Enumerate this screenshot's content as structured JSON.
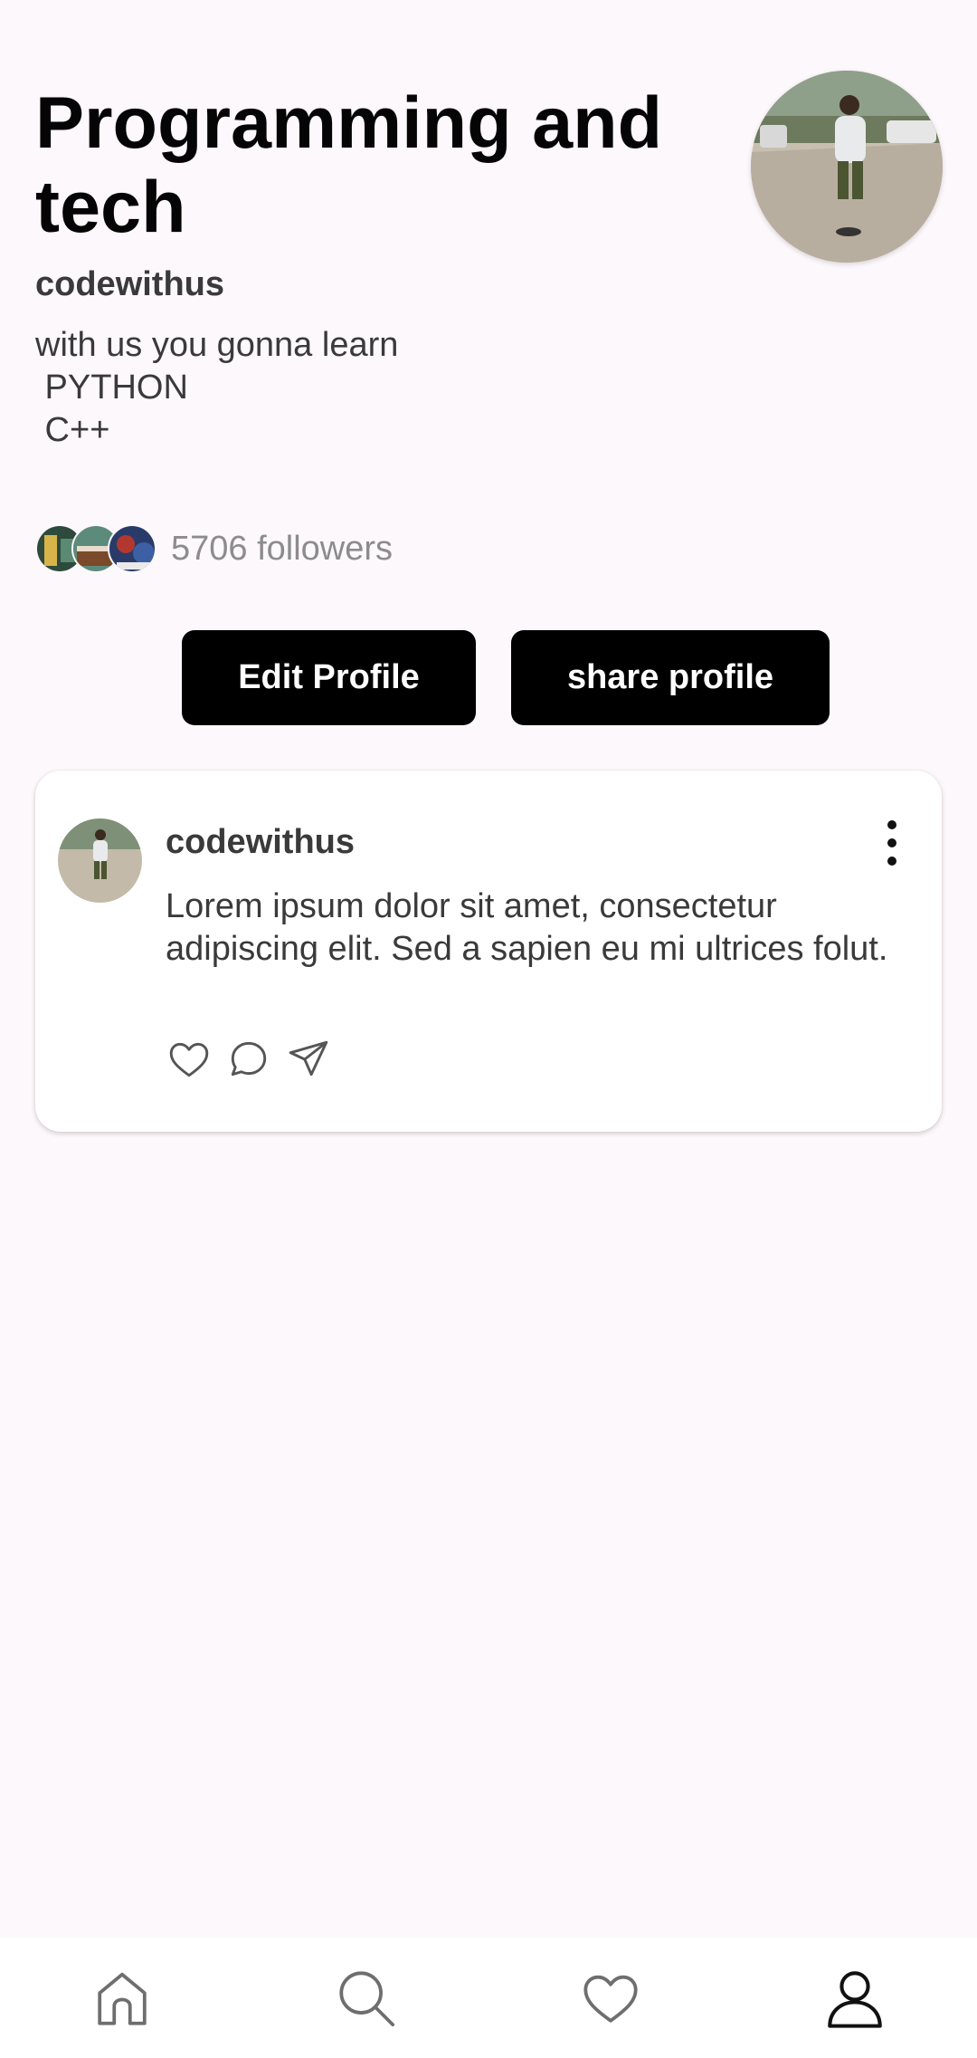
{
  "profile": {
    "title": "Programming and tech",
    "username": "codewithus",
    "bio": "with us you gonna learn\n PYTHON\n C++",
    "followers_text": "5706 followers"
  },
  "buttons": {
    "edit_label": "Edit Profile",
    "share_label": "share profile"
  },
  "post": {
    "username": "codewithus",
    "text": "Lorem ipsum dolor sit amet, consectetur adipiscing elit. Sed a sapien eu mi ultrices folut."
  },
  "icons": {
    "post_actions": [
      "heart-icon",
      "comment-icon",
      "send-icon"
    ],
    "nav": [
      "home-icon",
      "search-icon",
      "heart-icon",
      "person-icon"
    ]
  },
  "colors": {
    "background": "#fdf8fc",
    "button": "#000000",
    "secondary_text": "#8c8c8c"
  }
}
